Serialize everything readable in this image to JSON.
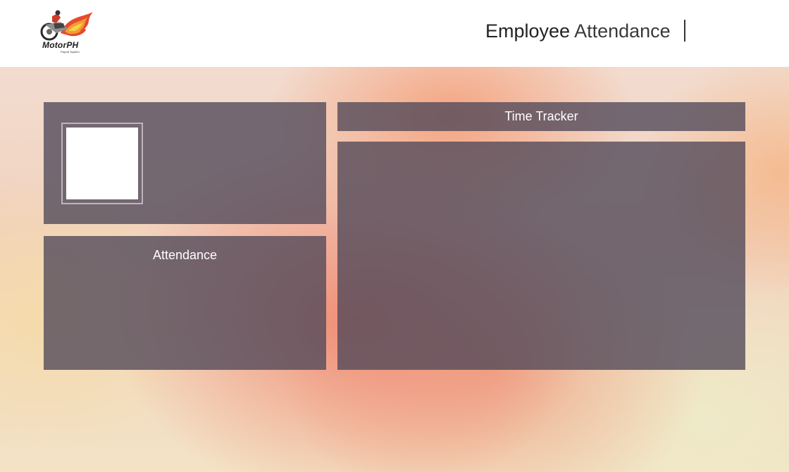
{
  "header": {
    "logo": {
      "brand": "MotorPH",
      "tagline": "Payroll System"
    },
    "title_strong": "Employee",
    "title_light": "Attendance"
  },
  "profile": {
    "photo_label": ""
  },
  "attendance": {
    "title": "Attendance"
  },
  "time_tracker": {
    "title": "Time Tracker"
  },
  "colors": {
    "panel": "#504858",
    "header_bg": "#ffffff",
    "title_text": "#2b2b2b",
    "panel_text": "#ffffff"
  }
}
